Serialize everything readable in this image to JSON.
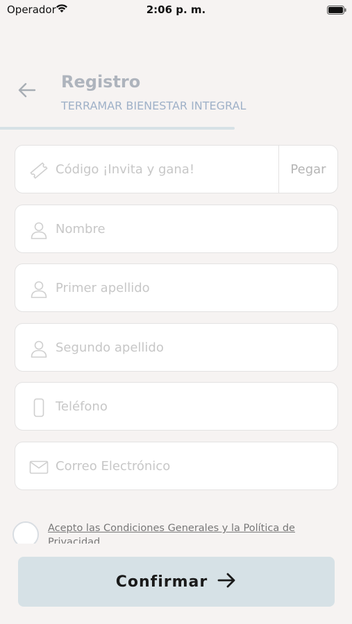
{
  "status_bar": {
    "carrier": "Operador",
    "time": "2:06 p. m."
  },
  "header": {
    "title": "Registro",
    "subtitle": "TERRAMAR BIENESTAR INTEGRAL",
    "progress": 0.667
  },
  "form": {
    "invite_code": {
      "placeholder": "Código ¡Invita y gana!",
      "value": "",
      "paste_label": "Pegar",
      "icon": "ticket-icon"
    },
    "first_name": {
      "placeholder": "Nombre",
      "value": "",
      "icon": "user-icon"
    },
    "last_name_1": {
      "placeholder": "Primer apellido",
      "value": "",
      "icon": "user-icon"
    },
    "last_name_2": {
      "placeholder": "Segundo apellido",
      "value": "",
      "icon": "user-icon"
    },
    "phone": {
      "placeholder": "Teléfono",
      "value": "",
      "icon": "phone-icon"
    },
    "email": {
      "placeholder": "Correo Electrónico",
      "value": "",
      "icon": "mail-icon"
    }
  },
  "terms": {
    "label": "Acepto las Condiciones Generales y la Política de Privacidad",
    "checked": false
  },
  "confirm": {
    "label": "Confirmar"
  },
  "colors": {
    "background": "#f6f3f2",
    "accent": "#d6e1e6",
    "title": "#aeb4bd",
    "subtitle": "#9fb1c8",
    "placeholder": "#c7c7c7"
  }
}
